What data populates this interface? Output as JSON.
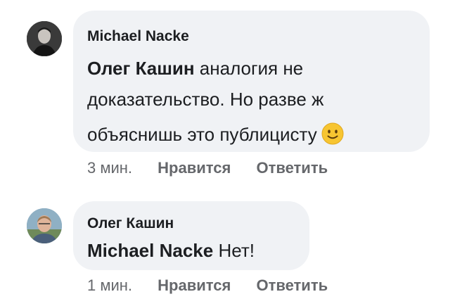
{
  "comments": [
    {
      "author": "Michael Nacke",
      "mention": "Олег Кашин",
      "line1": " аналогия не",
      "line2": "доказательство. Но разве ж",
      "line3": "объяснишь это публицисту",
      "emoji": "slightly-smiling-face-icon",
      "time": "3 мин.",
      "like": "Нравится",
      "reply": "Ответить"
    },
    {
      "author": "Олег Кашин",
      "mention": "Michael Nacke",
      "text": " Нет!",
      "time": "1 мин.",
      "like": "Нравится",
      "reply": "Ответить"
    }
  ],
  "colors": {
    "bubble": "#f0f2f5",
    "text": "#1c1e21",
    "meta": "#65676b",
    "emoji": "#f7c531"
  }
}
